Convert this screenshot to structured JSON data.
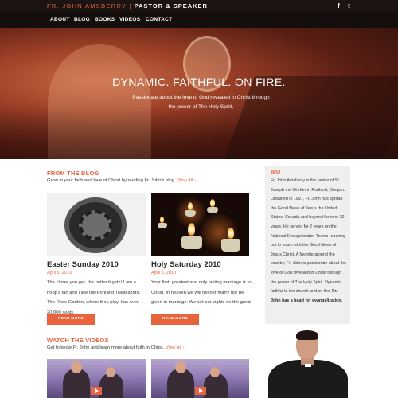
{
  "header": {
    "name": "FR. JOHN AMSBERRY",
    "separator": "|",
    "role": "PASTOR & SPEAKER",
    "social": [
      {
        "icon": "facebook-icon",
        "glyph": "f"
      },
      {
        "icon": "twitter-icon",
        "glyph": "t"
      }
    ]
  },
  "nav": {
    "items": [
      {
        "label": "ABOUT"
      },
      {
        "label": "BLOG"
      },
      {
        "label": "BOOKS"
      },
      {
        "label": "VIDEOS"
      },
      {
        "label": "CONTACT"
      }
    ]
  },
  "hero": {
    "title": "DYNAMIC. FAITHFUL. ON FIRE.",
    "subtitle": "Passionate about the love of God revealed in Christ through the power of The Holy Spirit."
  },
  "blog": {
    "heading": "FROM THE BLOG",
    "description": "Grow in your faith and love of Christ by reading Fr. John's blog.",
    "view_all": "View All",
    "posts": [
      {
        "title": "Easter Sunday 2010",
        "date": "April 5, 2010",
        "excerpt": "The closer you get, the better it gets! I am a hoop's fan and I like the Portland Trailblazers. The Rose Garden, where they play, has over 20,000 seats.",
        "button": "READ MORE"
      },
      {
        "title": "Holy Saturday 2010",
        "date": "April 5, 2010",
        "excerpt": "Your first, greatest and only lasting marriage is to Christ. In heaven we will neither marry nor be given in marriage. We set our sights on the great",
        "button": "READ MORE"
      }
    ]
  },
  "videos": {
    "heading": "WATCH THE VIDEOS",
    "description": "Get to know Fr. John and learn more about faith in Christ.",
    "view_all": "View All"
  },
  "bio": {
    "heading": "BIO",
    "text": "Fr. John Amsberry is the pastor of St. Joseph the Worker in Portland, Oregon. Ordained in 1997, Fr. John has spread the Good News of Jesus the United States, Canada and beyond for over 20 years. He served for 2 years on the National Evangelization Teams reaching out to youth with the Good News of Jesus Christ. A favorite around the country, Fr. John is passionate about the love of God revealed in Christ through the power of The Holy Spirit. Dynamic, faithful to the church and on fire,",
    "text_bold": "Fr. John has a heart for evangelization."
  },
  "colors": {
    "accent": "#e8643c",
    "topbar": "#1b1412",
    "nav": "#140f0d",
    "sidebar": "#efefef"
  }
}
